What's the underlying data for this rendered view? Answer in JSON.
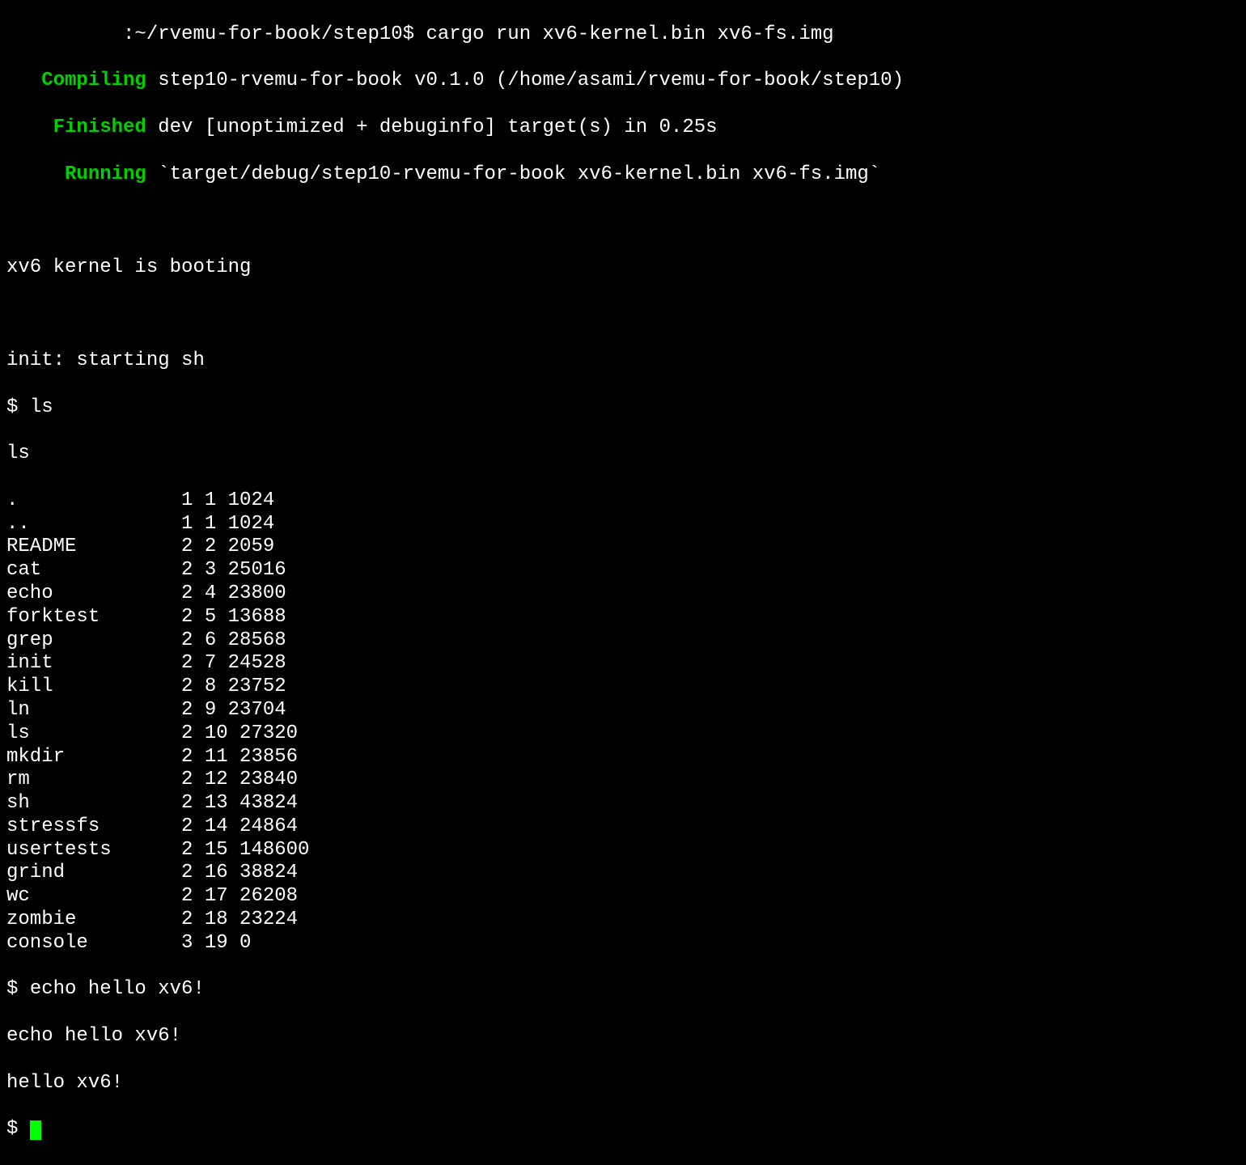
{
  "prompt_line": {
    "prefix": "          :~/rvemu-for-book/step10$ ",
    "command": "cargo run xv6-kernel.bin xv6-fs.img"
  },
  "cargo_output": {
    "compiling_label": "   Compiling",
    "compiling_text": " step10-rvemu-for-book v0.1.0 (/home/asami/rvemu-for-book/step10)",
    "finished_label": "    Finished",
    "finished_text": " dev [unoptimized + debuginfo] target(s) in 0.25s",
    "running_label": "     Running",
    "running_text": " `target/debug/step10-rvemu-for-book xv6-kernel.bin xv6-fs.img`"
  },
  "boot_message": "xv6 kernel is booting",
  "init_message": "init: starting sh",
  "shell": {
    "prompt": "$ ",
    "ls_command": "ls",
    "ls_echo": "ls",
    "echo_command": "echo hello xv6!",
    "echo_echo": "echo hello xv6!",
    "echo_output": "hello xv6!"
  },
  "ls_output": [
    {
      "name": ".",
      "type": "1",
      "inode": "1",
      "size": "1024"
    },
    {
      "name": "..",
      "type": "1",
      "inode": "1",
      "size": "1024"
    },
    {
      "name": "README",
      "type": "2",
      "inode": "2",
      "size": "2059"
    },
    {
      "name": "cat",
      "type": "2",
      "inode": "3",
      "size": "25016"
    },
    {
      "name": "echo",
      "type": "2",
      "inode": "4",
      "size": "23800"
    },
    {
      "name": "forktest",
      "type": "2",
      "inode": "5",
      "size": "13688"
    },
    {
      "name": "grep",
      "type": "2",
      "inode": "6",
      "size": "28568"
    },
    {
      "name": "init",
      "type": "2",
      "inode": "7",
      "size": "24528"
    },
    {
      "name": "kill",
      "type": "2",
      "inode": "8",
      "size": "23752"
    },
    {
      "name": "ln",
      "type": "2",
      "inode": "9",
      "size": "23704"
    },
    {
      "name": "ls",
      "type": "2",
      "inode": "10",
      "size": "27320"
    },
    {
      "name": "mkdir",
      "type": "2",
      "inode": "11",
      "size": "23856"
    },
    {
      "name": "rm",
      "type": "2",
      "inode": "12",
      "size": "23840"
    },
    {
      "name": "sh",
      "type": "2",
      "inode": "13",
      "size": "43824"
    },
    {
      "name": "stressfs",
      "type": "2",
      "inode": "14",
      "size": "24864"
    },
    {
      "name": "usertests",
      "type": "2",
      "inode": "15",
      "size": "148600"
    },
    {
      "name": "grind",
      "type": "2",
      "inode": "16",
      "size": "38824"
    },
    {
      "name": "wc",
      "type": "2",
      "inode": "17",
      "size": "26208"
    },
    {
      "name": "zombie",
      "type": "2",
      "inode": "18",
      "size": "23224"
    },
    {
      "name": "console",
      "type": "3",
      "inode": "19",
      "size": "0"
    }
  ]
}
